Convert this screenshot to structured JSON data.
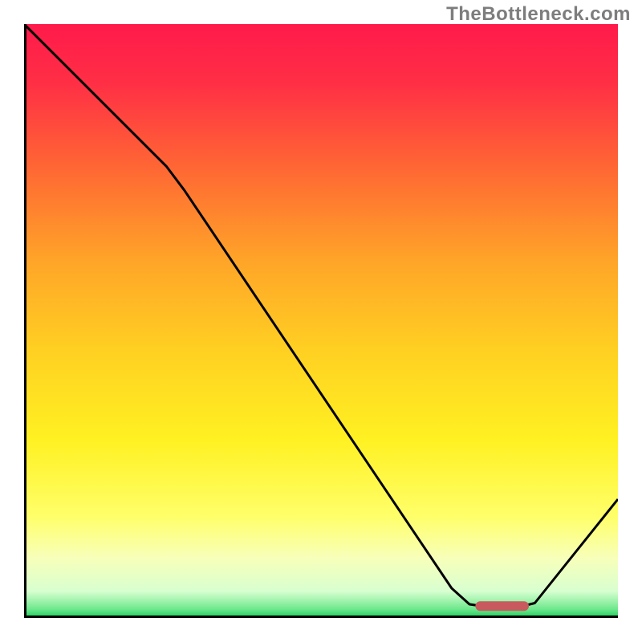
{
  "watermark": "TheBottleneck.com",
  "chart_data": {
    "type": "line",
    "title": "",
    "xlabel": "",
    "ylabel": "",
    "xlim": [
      0,
      100
    ],
    "ylim": [
      0,
      100
    ],
    "grid": false,
    "curve": [
      {
        "x": 0,
        "y": 100
      },
      {
        "x": 24,
        "y": 76
      },
      {
        "x": 27,
        "y": 72
      },
      {
        "x": 72,
        "y": 5
      },
      {
        "x": 75,
        "y": 2.3
      },
      {
        "x": 77,
        "y": 2.0
      },
      {
        "x": 84,
        "y": 2.0
      },
      {
        "x": 86,
        "y": 2.5
      },
      {
        "x": 100,
        "y": 20
      }
    ],
    "marker": {
      "x_start": 76,
      "x_end": 85,
      "y": 2.0
    },
    "gradient_stops": [
      {
        "offset": 0.0,
        "color": "#ff1a4b"
      },
      {
        "offset": 0.1,
        "color": "#ff2f45"
      },
      {
        "offset": 0.25,
        "color": "#ff6a33"
      },
      {
        "offset": 0.4,
        "color": "#ffa528"
      },
      {
        "offset": 0.55,
        "color": "#ffd022"
      },
      {
        "offset": 0.7,
        "color": "#fff122"
      },
      {
        "offset": 0.83,
        "color": "#ffff6a"
      },
      {
        "offset": 0.9,
        "color": "#f7ffba"
      },
      {
        "offset": 0.955,
        "color": "#d8ffd0"
      },
      {
        "offset": 0.985,
        "color": "#6fe88e"
      },
      {
        "offset": 1.0,
        "color": "#18cc5a"
      }
    ],
    "marker_color": "#c85a5e",
    "curve_color": "#000000",
    "axis_color": "#000000"
  }
}
